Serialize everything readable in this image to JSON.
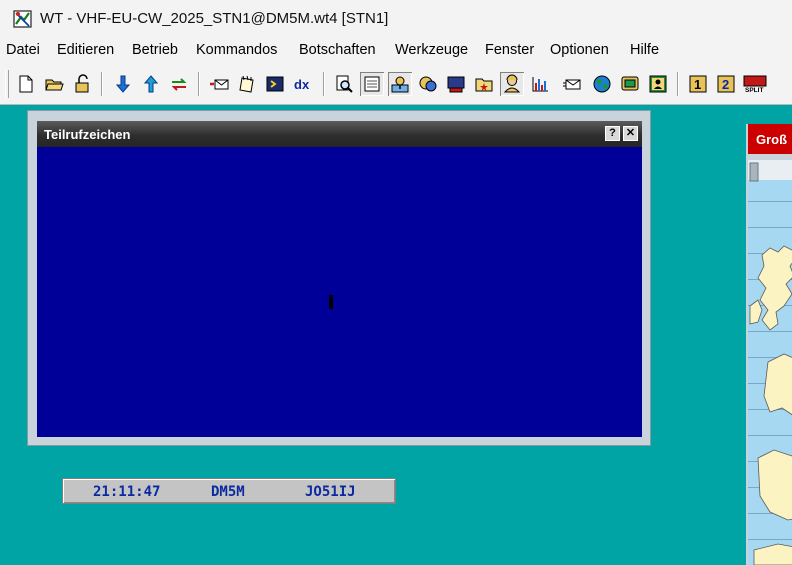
{
  "window": {
    "title": "WT - VHF-EU-CW_2025_STN1@DM5M.wt4 [STN1]",
    "icon": "wt-app-icon"
  },
  "menu": {
    "items": [
      {
        "label": "Datei"
      },
      {
        "label": "Editieren"
      },
      {
        "label": "Betrieb"
      },
      {
        "label": "Kommandos"
      },
      {
        "label": "Botschaften"
      },
      {
        "label": "Werkzeuge"
      },
      {
        "label": "Fenster"
      },
      {
        "label": "Optionen"
      },
      {
        "label": "Hilfe"
      }
    ]
  },
  "toolbar": {
    "buttons": [
      {
        "icon": "new-document-icon"
      },
      {
        "icon": "open-folder-icon"
      },
      {
        "icon": "unlock-icon"
      },
      {
        "icon": "arrow-down-icon"
      },
      {
        "icon": "arrow-up-icon"
      },
      {
        "icon": "transfer-icon"
      },
      {
        "icon": "envelope-send-icon"
      },
      {
        "icon": "notepad-icon"
      },
      {
        "icon": "script-icon"
      },
      {
        "icon": "dx-icon",
        "text": "dx"
      },
      {
        "icon": "magnifier-icon"
      },
      {
        "icon": "log-list-icon"
      },
      {
        "icon": "map-pin-icon"
      },
      {
        "icon": "multiplier-icon"
      },
      {
        "icon": "terminal-icon"
      },
      {
        "icon": "folder-star-icon"
      },
      {
        "icon": "operator-icon"
      },
      {
        "icon": "statistics-chart-icon"
      },
      {
        "icon": "mail-icon"
      },
      {
        "icon": "globe-icon"
      },
      {
        "icon": "monitor-icon"
      },
      {
        "icon": "window-person-icon"
      },
      {
        "icon": "radio-1-icon",
        "text": "1"
      },
      {
        "icon": "radio-2-icon",
        "text": "2"
      },
      {
        "icon": "split-icon",
        "text": "SPLIT"
      }
    ]
  },
  "partial_window": {
    "title": "Teilrufzeichen",
    "help_symbol": "?",
    "close_symbol": "✕"
  },
  "status": {
    "time": "21:11:47",
    "callsign": "DM5M",
    "locator": "JO51IJ"
  },
  "map_window": {
    "title": "Groß"
  }
}
